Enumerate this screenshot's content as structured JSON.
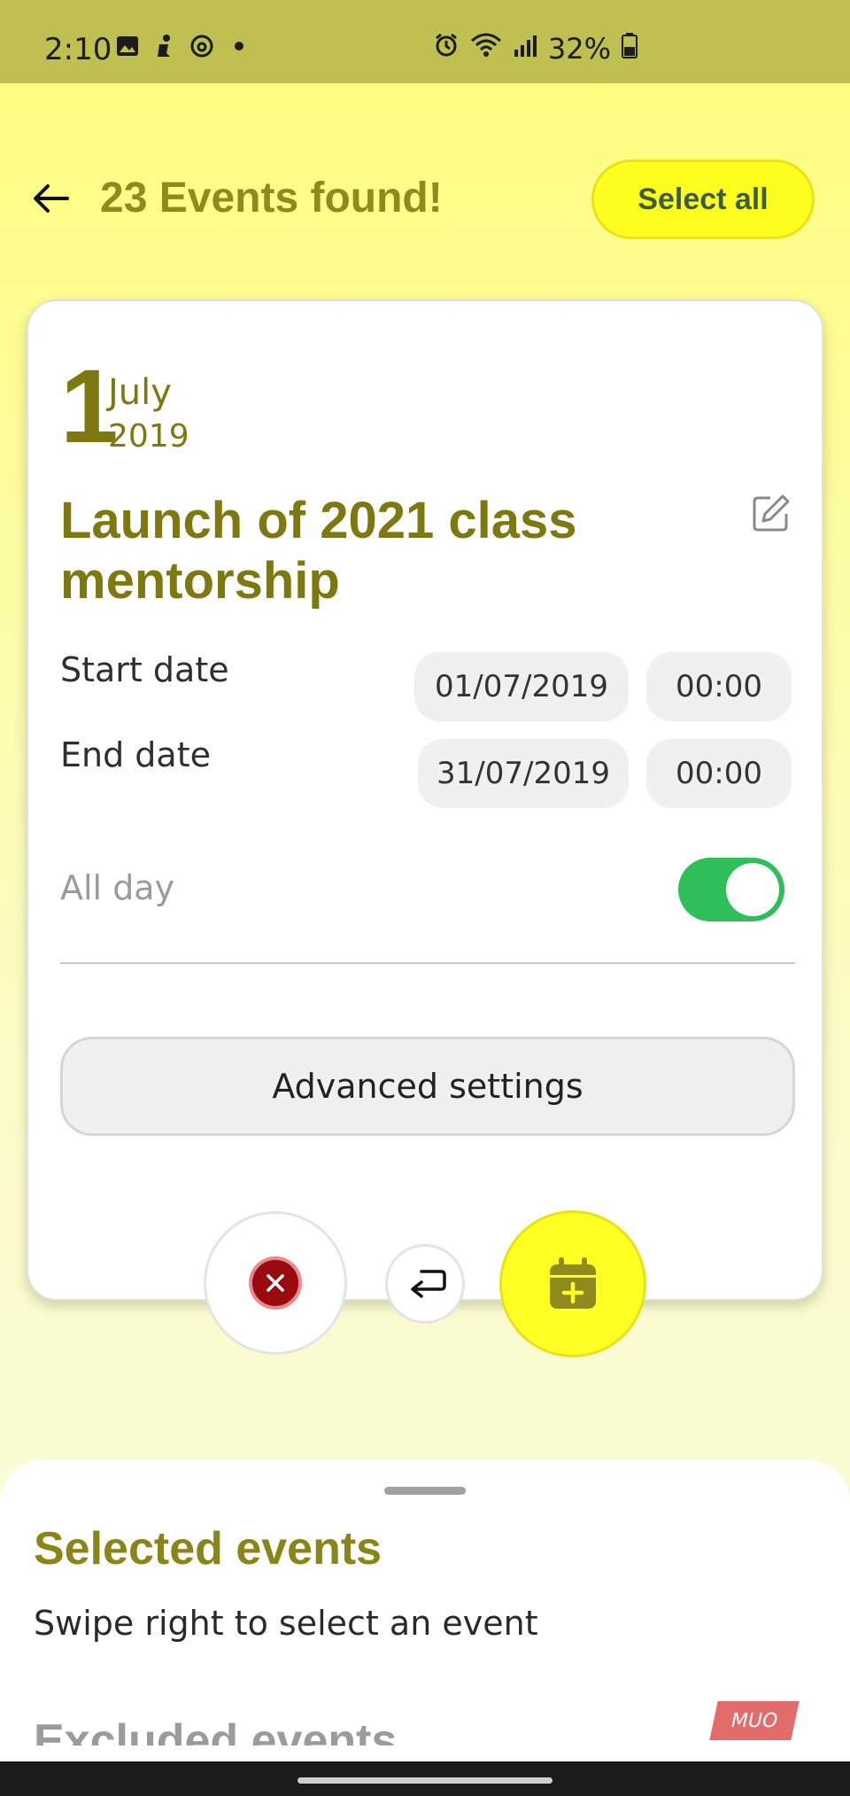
{
  "status_bar": {
    "time": "2:10",
    "battery": "32%",
    "icons": [
      "gallery-icon",
      "accessibility-icon",
      "threads-icon",
      "dot-icon",
      "alarm-icon",
      "wifi-icon",
      "signal-icon",
      "battery-icon"
    ]
  },
  "header": {
    "title": "23 Events found!",
    "select_all_label": "Select all"
  },
  "event": {
    "day": "1",
    "month": "July",
    "year": "2019",
    "title": "Launch of 2021 class mentorship",
    "start_label": "Start date",
    "start_date": "01/07/2019",
    "start_time": "00:00",
    "end_label": "End date",
    "end_date": "31/07/2019",
    "end_time": "00:00",
    "all_day_label": "All day",
    "all_day": true,
    "advanced_label": "Advanced settings"
  },
  "actions": {
    "reject_icon": "x-icon",
    "undo_icon": "undo-icon",
    "add_icon": "calendar-plus-icon"
  },
  "sheet": {
    "title": "Selected events",
    "hint": "Swipe right to select an event",
    "excluded_title": "Excluded events",
    "watermark": "MUO"
  },
  "colors": {
    "accent_yellow": "#ffff24",
    "title_olive": "#7d780f",
    "toggle_green": "#2fbe5a",
    "reject_red": "#9a0b10"
  }
}
